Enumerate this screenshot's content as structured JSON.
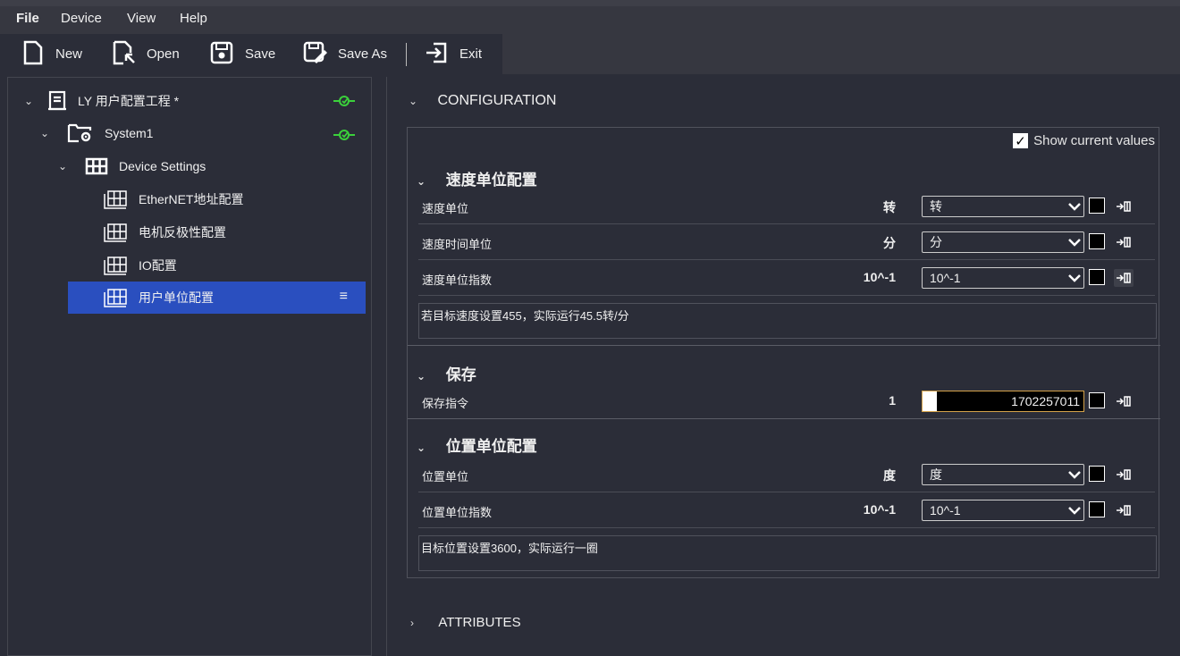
{
  "menu": {
    "items": [
      "File",
      "Device",
      "View",
      "Help"
    ]
  },
  "toolbar": {
    "new_label": "New",
    "open_label": "Open",
    "save_label": "Save",
    "save_as_label": "Save As",
    "exit_label": "Exit"
  },
  "tree": {
    "project": {
      "label": "LY 用户配置工程 *",
      "icon": "project-icon"
    },
    "system": {
      "label": "System1",
      "icon": "folder-settings-icon"
    },
    "device_settings": {
      "label": "Device Settings",
      "icon": "grid-icon"
    },
    "items": [
      {
        "label": "EtherNET地址配置"
      },
      {
        "label": "电机反极性配置"
      },
      {
        "label": "IO配置"
      },
      {
        "label": "用户单位配置",
        "selected": true
      }
    ],
    "selected_menu_glyph": "≡"
  },
  "config": {
    "heading": "CONFIGURATION",
    "show_current_label": "Show current values",
    "show_current_checked": true,
    "groups": [
      {
        "title": "速度单位配置",
        "params": [
          {
            "label": "速度单位",
            "value": "转",
            "select": "转"
          },
          {
            "label": "速度时间单位",
            "value": "分",
            "select": "分"
          },
          {
            "label": "速度单位指数",
            "value": "10^-1",
            "select": "10^-1"
          }
        ],
        "description": "若目标速度设置455，实际运行45.5转/分"
      },
      {
        "title": "保存",
        "params": [
          {
            "label": "保存指令",
            "value": "1",
            "input": "1702257011"
          }
        ]
      },
      {
        "title": "位置单位配置",
        "params": [
          {
            "label": "位置单位",
            "value": "度",
            "select": "度"
          },
          {
            "label": "位置单位指数",
            "value": "10^-1",
            "select": "10^-1"
          }
        ],
        "description": "目标位置设置3600，实际运行一圈"
      }
    ]
  },
  "attributes": {
    "heading": "ATTRIBUTES"
  },
  "colors": {
    "background": "#2b2d38",
    "selected": "#2a4fbf",
    "link_icon": "#3bd13b",
    "input_border": "#d4a24a"
  }
}
